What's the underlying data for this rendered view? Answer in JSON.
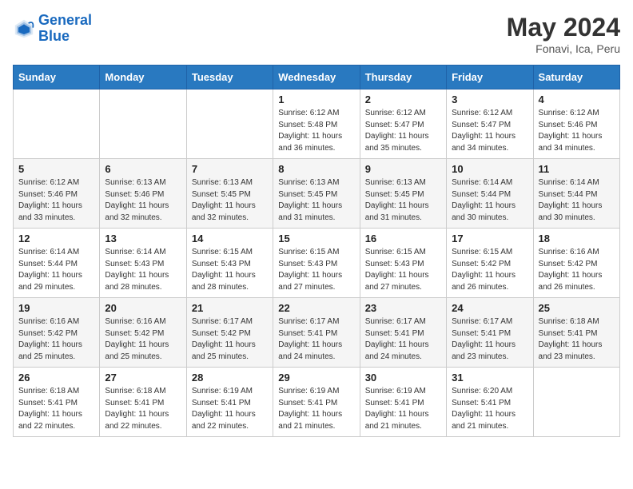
{
  "header": {
    "logo_general": "General",
    "logo_blue": "Blue",
    "month": "May 2024",
    "location": "Fonavi, Ica, Peru"
  },
  "weekdays": [
    "Sunday",
    "Monday",
    "Tuesday",
    "Wednesday",
    "Thursday",
    "Friday",
    "Saturday"
  ],
  "weeks": [
    [
      {
        "day": "",
        "sunrise": "",
        "sunset": "",
        "daylight": ""
      },
      {
        "day": "",
        "sunrise": "",
        "sunset": "",
        "daylight": ""
      },
      {
        "day": "",
        "sunrise": "",
        "sunset": "",
        "daylight": ""
      },
      {
        "day": "1",
        "sunrise": "6:12 AM",
        "sunset": "5:48 PM",
        "daylight": "11 hours and 36 minutes."
      },
      {
        "day": "2",
        "sunrise": "6:12 AM",
        "sunset": "5:47 PM",
        "daylight": "11 hours and 35 minutes."
      },
      {
        "day": "3",
        "sunrise": "6:12 AM",
        "sunset": "5:47 PM",
        "daylight": "11 hours and 34 minutes."
      },
      {
        "day": "4",
        "sunrise": "6:12 AM",
        "sunset": "5:46 PM",
        "daylight": "11 hours and 34 minutes."
      }
    ],
    [
      {
        "day": "5",
        "sunrise": "6:12 AM",
        "sunset": "5:46 PM",
        "daylight": "11 hours and 33 minutes."
      },
      {
        "day": "6",
        "sunrise": "6:13 AM",
        "sunset": "5:46 PM",
        "daylight": "11 hours and 32 minutes."
      },
      {
        "day": "7",
        "sunrise": "6:13 AM",
        "sunset": "5:45 PM",
        "daylight": "11 hours and 32 minutes."
      },
      {
        "day": "8",
        "sunrise": "6:13 AM",
        "sunset": "5:45 PM",
        "daylight": "11 hours and 31 minutes."
      },
      {
        "day": "9",
        "sunrise": "6:13 AM",
        "sunset": "5:45 PM",
        "daylight": "11 hours and 31 minutes."
      },
      {
        "day": "10",
        "sunrise": "6:14 AM",
        "sunset": "5:44 PM",
        "daylight": "11 hours and 30 minutes."
      },
      {
        "day": "11",
        "sunrise": "6:14 AM",
        "sunset": "5:44 PM",
        "daylight": "11 hours and 30 minutes."
      }
    ],
    [
      {
        "day": "12",
        "sunrise": "6:14 AM",
        "sunset": "5:44 PM",
        "daylight": "11 hours and 29 minutes."
      },
      {
        "day": "13",
        "sunrise": "6:14 AM",
        "sunset": "5:43 PM",
        "daylight": "11 hours and 28 minutes."
      },
      {
        "day": "14",
        "sunrise": "6:15 AM",
        "sunset": "5:43 PM",
        "daylight": "11 hours and 28 minutes."
      },
      {
        "day": "15",
        "sunrise": "6:15 AM",
        "sunset": "5:43 PM",
        "daylight": "11 hours and 27 minutes."
      },
      {
        "day": "16",
        "sunrise": "6:15 AM",
        "sunset": "5:43 PM",
        "daylight": "11 hours and 27 minutes."
      },
      {
        "day": "17",
        "sunrise": "6:15 AM",
        "sunset": "5:42 PM",
        "daylight": "11 hours and 26 minutes."
      },
      {
        "day": "18",
        "sunrise": "6:16 AM",
        "sunset": "5:42 PM",
        "daylight": "11 hours and 26 minutes."
      }
    ],
    [
      {
        "day": "19",
        "sunrise": "6:16 AM",
        "sunset": "5:42 PM",
        "daylight": "11 hours and 25 minutes."
      },
      {
        "day": "20",
        "sunrise": "6:16 AM",
        "sunset": "5:42 PM",
        "daylight": "11 hours and 25 minutes."
      },
      {
        "day": "21",
        "sunrise": "6:17 AM",
        "sunset": "5:42 PM",
        "daylight": "11 hours and 25 minutes."
      },
      {
        "day": "22",
        "sunrise": "6:17 AM",
        "sunset": "5:41 PM",
        "daylight": "11 hours and 24 minutes."
      },
      {
        "day": "23",
        "sunrise": "6:17 AM",
        "sunset": "5:41 PM",
        "daylight": "11 hours and 24 minutes."
      },
      {
        "day": "24",
        "sunrise": "6:17 AM",
        "sunset": "5:41 PM",
        "daylight": "11 hours and 23 minutes."
      },
      {
        "day": "25",
        "sunrise": "6:18 AM",
        "sunset": "5:41 PM",
        "daylight": "11 hours and 23 minutes."
      }
    ],
    [
      {
        "day": "26",
        "sunrise": "6:18 AM",
        "sunset": "5:41 PM",
        "daylight": "11 hours and 22 minutes."
      },
      {
        "day": "27",
        "sunrise": "6:18 AM",
        "sunset": "5:41 PM",
        "daylight": "11 hours and 22 minutes."
      },
      {
        "day": "28",
        "sunrise": "6:19 AM",
        "sunset": "5:41 PM",
        "daylight": "11 hours and 22 minutes."
      },
      {
        "day": "29",
        "sunrise": "6:19 AM",
        "sunset": "5:41 PM",
        "daylight": "11 hours and 21 minutes."
      },
      {
        "day": "30",
        "sunrise": "6:19 AM",
        "sunset": "5:41 PM",
        "daylight": "11 hours and 21 minutes."
      },
      {
        "day": "31",
        "sunrise": "6:20 AM",
        "sunset": "5:41 PM",
        "daylight": "11 hours and 21 minutes."
      },
      {
        "day": "",
        "sunrise": "",
        "sunset": "",
        "daylight": ""
      }
    ]
  ]
}
